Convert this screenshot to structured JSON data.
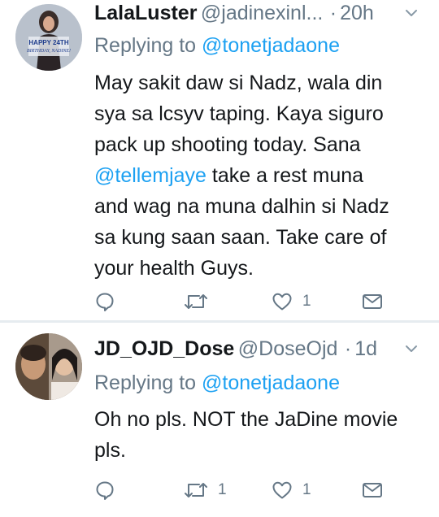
{
  "tweets": [
    {
      "name": "LalaLuster",
      "handle": "@jadinexinl...",
      "separator": "·",
      "time": "20h",
      "avatar_caption": [
        "HAPPY 24TH",
        "BIRTHDAY, NADINE!"
      ],
      "replying_prefix": "Replying to",
      "replying_to": "@tonetjadaone",
      "body": {
        "line1": "May sakit daw si Nadz, wala din",
        "line2": "sya sa lcsyv taping. Kaya siguro",
        "line3": "pack up shooting today. Sana",
        "line4_mention": "@tellemjaye",
        "line4_rest": " take a rest muna",
        "line5": "and wag na muna dalhin si Nadz",
        "line6": "sa kung saan saan. Take care of",
        "line7": "your health Guys."
      },
      "actions": {
        "reply_count": "",
        "retweet_count": "",
        "like_count": "1"
      }
    },
    {
      "name": "JD_OJD_Dose",
      "handle": "@DoseOjd",
      "separator": "·",
      "time": "1d",
      "replying_prefix": "Replying to",
      "replying_to": "@tonetjadaone",
      "body": {
        "line1": "Oh no pls. NOT the JaDine movie",
        "line2": "pls."
      },
      "actions": {
        "reply_count": "",
        "retweet_count": "1",
        "like_count": "1"
      }
    }
  ],
  "colors": {
    "text_primary": "#14171a",
    "text_secondary": "#657786",
    "link": "#1da1f2",
    "divider": "#e6ecf0"
  },
  "icons": [
    "reply-icon",
    "retweet-icon",
    "like-icon",
    "direct-message-icon",
    "chevron-down-icon"
  ]
}
